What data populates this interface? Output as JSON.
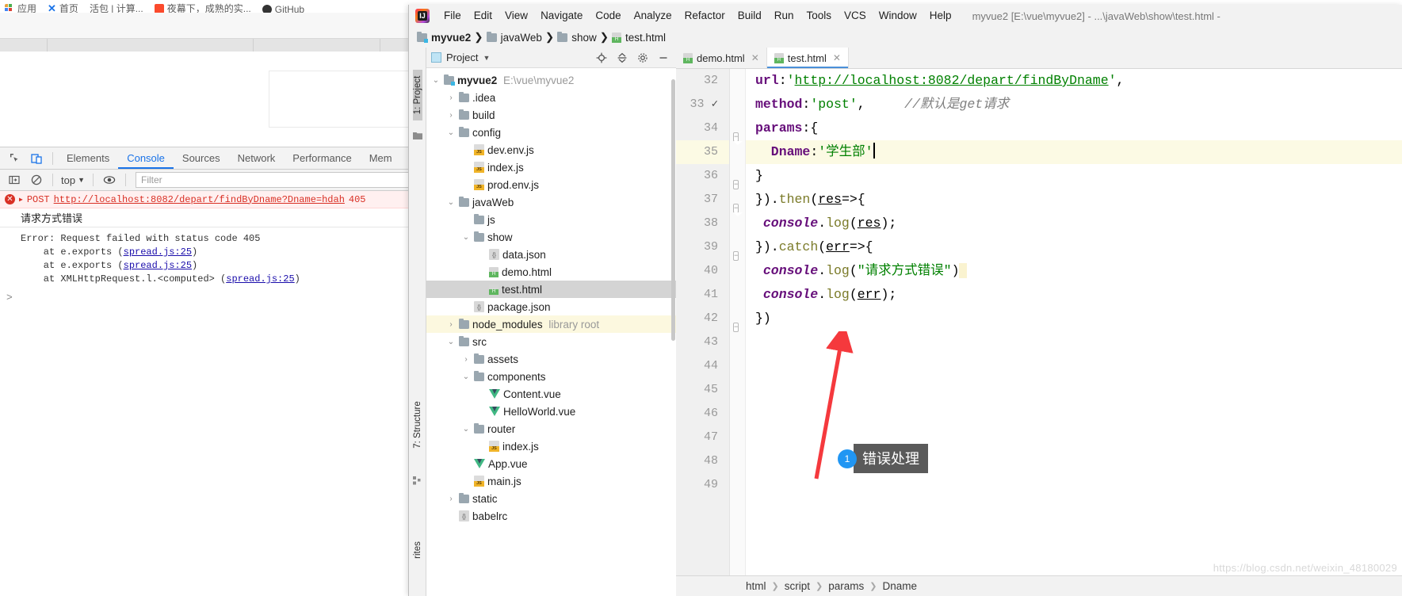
{
  "browser": {
    "bookmarks": [
      {
        "icon": "apps-grid-icon",
        "label": "应用"
      },
      {
        "icon": "x-icon",
        "label": "首页"
      },
      {
        "icon": "none",
        "label": "活包 | 计算..."
      },
      {
        "icon": "red-square-icon",
        "label": "夜幕下，成熟的实..."
      },
      {
        "icon": "github-icon",
        "label": "GitHub"
      }
    ],
    "devtools": {
      "toolbar_icons": [
        "inspect-element-icon",
        "device-toolbar-icon"
      ],
      "tabs": [
        "Elements",
        "Console",
        "Sources",
        "Network",
        "Performance",
        "Mem"
      ],
      "active_tab": "Console",
      "filter_icons": [
        "sidebar-toggle-icon",
        "clear-console-icon",
        "eye-icon"
      ],
      "context": "top",
      "filter_placeholder": "Filter",
      "error_method": "POST",
      "error_url": "http://localhost:8082/depart/findByDname?Dname=hdah",
      "error_status": "405",
      "log_message": "请求方式错误",
      "stack": [
        {
          "text": "Error: Request failed with status code 405",
          "link": ""
        },
        {
          "text": "    at e.exports (",
          "link": "spread.js:25",
          "tail": ")"
        },
        {
          "text": "    at e.exports (",
          "link": "spread.js:25",
          "tail": ")"
        },
        {
          "text": "    at XMLHttpRequest.l.<computed> (",
          "link": "spread.js:25",
          "tail": ")"
        }
      ],
      "prompt": ">"
    }
  },
  "ide": {
    "menu": [
      "File",
      "Edit",
      "View",
      "Navigate",
      "Code",
      "Analyze",
      "Refactor",
      "Build",
      "Run",
      "Tools",
      "VCS",
      "Window",
      "Help"
    ],
    "window_title": "myvue2 [E:\\vue\\myvue2] - ...\\javaWeb\\show\\test.html -",
    "breadcrumb": [
      {
        "label": "myvue2",
        "icon": "project-folder-icon",
        "bold": true
      },
      {
        "label": "javaWeb",
        "icon": "folder-icon",
        "bold": false
      },
      {
        "label": "show",
        "icon": "folder-icon",
        "bold": false
      },
      {
        "label": "test.html",
        "icon": "html-file-icon",
        "bold": false
      }
    ],
    "left_strip": {
      "top_label": "1: Project",
      "mid_label": "7: Structure",
      "bottom_label": "rites"
    },
    "project_panel": {
      "title": "Project",
      "header_icons": [
        "locate-icon",
        "collapse-all-icon",
        "settings-gear-icon",
        "hide-icon"
      ],
      "tree": [
        {
          "depth": 0,
          "chev": "down",
          "icon": "project-folder-icon",
          "label": "myvue2",
          "bold": true,
          "dim": "E:\\vue\\myvue2"
        },
        {
          "depth": 1,
          "chev": "right",
          "icon": "folder-icon",
          "label": ".idea"
        },
        {
          "depth": 1,
          "chev": "right",
          "icon": "folder-icon",
          "label": "build"
        },
        {
          "depth": 1,
          "chev": "down",
          "icon": "folder-icon",
          "label": "config"
        },
        {
          "depth": 2,
          "chev": "none",
          "icon": "js-file-icon",
          "label": "dev.env.js"
        },
        {
          "depth": 2,
          "chev": "none",
          "icon": "js-file-icon",
          "label": "index.js"
        },
        {
          "depth": 2,
          "chev": "none",
          "icon": "js-file-icon",
          "label": "prod.env.js"
        },
        {
          "depth": 1,
          "chev": "down",
          "icon": "folder-icon",
          "label": "javaWeb"
        },
        {
          "depth": 2,
          "chev": "none",
          "icon": "folder-icon",
          "label": "js"
        },
        {
          "depth": 2,
          "chev": "down",
          "icon": "folder-icon",
          "label": "show"
        },
        {
          "depth": 3,
          "chev": "none",
          "icon": "json-file-icon",
          "label": "data.json"
        },
        {
          "depth": 3,
          "chev": "none",
          "icon": "html-file-icon",
          "label": "demo.html"
        },
        {
          "depth": 3,
          "chev": "none",
          "icon": "html-file-icon",
          "label": "test.html",
          "selected": true
        },
        {
          "depth": 2,
          "chev": "none",
          "icon": "json-file-icon",
          "label": "package.json"
        },
        {
          "depth": 1,
          "chev": "right",
          "icon": "folder-icon",
          "label": "node_modules",
          "dim": "library root",
          "highlight": true
        },
        {
          "depth": 1,
          "chev": "down",
          "icon": "folder-icon",
          "label": "src"
        },
        {
          "depth": 2,
          "chev": "right",
          "icon": "folder-icon",
          "label": "assets"
        },
        {
          "depth": 2,
          "chev": "down",
          "icon": "folder-icon",
          "label": "components"
        },
        {
          "depth": 3,
          "chev": "none",
          "icon": "vue-file-icon",
          "label": "Content.vue"
        },
        {
          "depth": 3,
          "chev": "none",
          "icon": "vue-file-icon",
          "label": "HelloWorld.vue"
        },
        {
          "depth": 2,
          "chev": "down",
          "icon": "folder-icon",
          "label": "router"
        },
        {
          "depth": 3,
          "chev": "none",
          "icon": "js-file-icon",
          "label": "index.js"
        },
        {
          "depth": 2,
          "chev": "none",
          "icon": "vue-file-icon",
          "label": "App.vue"
        },
        {
          "depth": 2,
          "chev": "none",
          "icon": "js-file-icon",
          "label": "main.js"
        },
        {
          "depth": 1,
          "chev": "right",
          "icon": "folder-icon",
          "label": "static"
        },
        {
          "depth": 1,
          "chev": "none",
          "icon": "config-file-icon",
          "label": "babelrc"
        }
      ]
    },
    "editor": {
      "tabs": [
        {
          "label": "demo.html",
          "icon": "html-file-icon",
          "active": false
        },
        {
          "label": "test.html",
          "icon": "html-file-icon",
          "active": true
        }
      ],
      "first_line_number": 32,
      "lines": [
        {
          "n": "32",
          "fold": "none",
          "check": false,
          "hl": false,
          "tokens": [
            {
              "t": "url",
              "c": "k-prop"
            },
            {
              "t": ":",
              "c": "k-punc"
            },
            {
              "t": "'",
              "c": "k-str"
            },
            {
              "t": "http://localhost:8082/depart/findByDname",
              "c": "k-link"
            },
            {
              "t": "'",
              "c": "k-str"
            },
            {
              "t": ",",
              "c": "k-punc"
            }
          ]
        },
        {
          "n": "33",
          "fold": "none",
          "check": true,
          "hl": false,
          "tokens": [
            {
              "t": "method",
              "c": "k-prop"
            },
            {
              "t": ":",
              "c": "k-punc"
            },
            {
              "t": "'post'",
              "c": "k-str"
            },
            {
              "t": ",",
              "c": "k-punc"
            },
            {
              "t": "     //默认是get请求",
              "c": "k-cmt"
            }
          ]
        },
        {
          "n": "34",
          "fold": "start",
          "check": false,
          "hl": false,
          "tokens": [
            {
              "t": "params",
              "c": "k-prop"
            },
            {
              "t": ":{",
              "c": "k-punc"
            }
          ]
        },
        {
          "n": "35",
          "fold": "none",
          "check": false,
          "hl": true,
          "tokens": [
            {
              "t": "  Dname",
              "c": "k-prop"
            },
            {
              "t": ":",
              "c": "k-punc"
            },
            {
              "t": "'学生部'",
              "c": "k-str"
            }
          ]
        },
        {
          "n": "36",
          "fold": "end",
          "check": false,
          "hl": false,
          "tokens": [
            {
              "t": "}",
              "c": "k-punc"
            }
          ]
        },
        {
          "n": "37",
          "fold": "start",
          "check": false,
          "hl": false,
          "tokens": [
            {
              "t": "}).",
              "c": "k-punc"
            },
            {
              "t": "then",
              "c": "k-fn"
            },
            {
              "t": "(",
              "c": "k-punc"
            },
            {
              "t": "res",
              "c": "k-var"
            },
            {
              "t": "=>{",
              "c": "k-punc"
            }
          ]
        },
        {
          "n": "38",
          "fold": "none",
          "check": false,
          "hl": false,
          "tokens": [
            {
              "t": " console",
              "c": "k-obj"
            },
            {
              "t": ".",
              "c": "k-punc"
            },
            {
              "t": "log",
              "c": "k-fn"
            },
            {
              "t": "(",
              "c": "k-punc"
            },
            {
              "t": "res",
              "c": "k-var"
            },
            {
              "t": ");",
              "c": "k-punc"
            }
          ]
        },
        {
          "n": "39",
          "fold": "end",
          "check": false,
          "hl": false,
          "tokens": [
            {
              "t": "}).",
              "c": "k-punc"
            },
            {
              "t": "catch",
              "c": "k-fn"
            },
            {
              "t": "(",
              "c": "k-punc"
            },
            {
              "t": "err",
              "c": "k-var"
            },
            {
              "t": "=>{",
              "c": "k-punc"
            }
          ]
        },
        {
          "n": "40",
          "fold": "none",
          "check": false,
          "hl": false,
          "tokens": [
            {
              "t": " console",
              "c": "k-obj"
            },
            {
              "t": ".",
              "c": "k-punc"
            },
            {
              "t": "log",
              "c": "k-fn"
            },
            {
              "t": "(",
              "c": "k-punc"
            },
            {
              "t": "\"请求方式错误\"",
              "c": "k-str"
            },
            {
              "t": ")",
              "c": "k-punc"
            }
          ]
        },
        {
          "n": "41",
          "fold": "none",
          "check": false,
          "hl": false,
          "tokens": [
            {
              "t": " console",
              "c": "k-obj"
            },
            {
              "t": ".",
              "c": "k-punc"
            },
            {
              "t": "log",
              "c": "k-fn"
            },
            {
              "t": "(",
              "c": "k-punc"
            },
            {
              "t": "err",
              "c": "k-var"
            },
            {
              "t": ");",
              "c": "k-punc"
            }
          ]
        },
        {
          "n": "42",
          "fold": "end",
          "check": false,
          "hl": false,
          "tokens": [
            {
              "t": "})",
              "c": "k-punc"
            }
          ]
        },
        {
          "n": "43",
          "fold": "none",
          "check": false,
          "hl": false,
          "tokens": []
        },
        {
          "n": "44",
          "fold": "none",
          "check": false,
          "hl": false,
          "tokens": []
        },
        {
          "n": "45",
          "fold": "none",
          "check": false,
          "hl": false,
          "tokens": []
        },
        {
          "n": "46",
          "fold": "none",
          "check": false,
          "hl": false,
          "tokens": []
        },
        {
          "n": "47",
          "fold": "none",
          "check": false,
          "hl": false,
          "tokens": []
        },
        {
          "n": "48",
          "fold": "none",
          "check": false,
          "hl": false,
          "tokens": []
        },
        {
          "n": "49",
          "fold": "none",
          "check": false,
          "hl": false,
          "tokens": []
        }
      ]
    },
    "status_breadcrumb": [
      "html",
      "script",
      "params",
      "Dname"
    ]
  },
  "annotation": {
    "number": "1",
    "label": "错误处理",
    "arrow_color": "#f5393d",
    "badge_color": "#2196f3",
    "box_color": "#5a5a5a"
  },
  "watermark": "https://blog.csdn.net/weixin_48180029"
}
